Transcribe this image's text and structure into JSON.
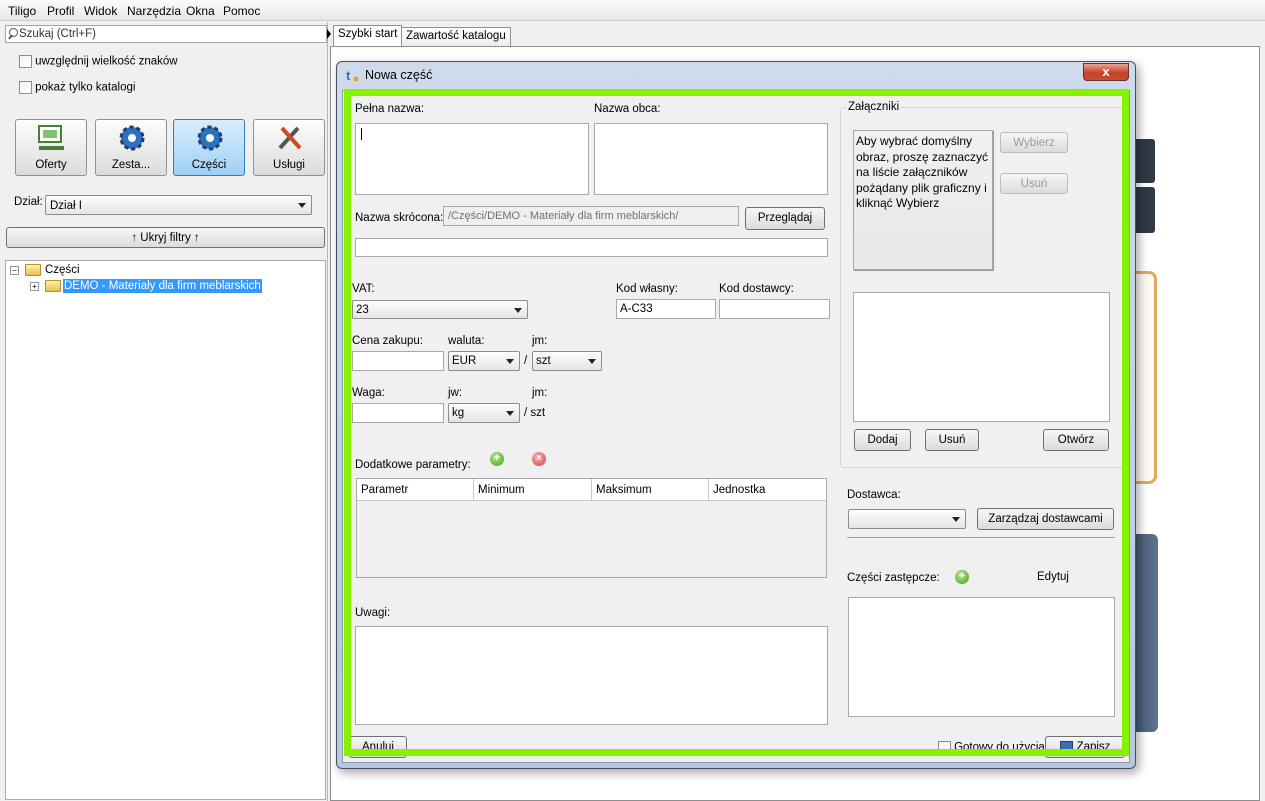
{
  "menu": [
    "Tiligo",
    "Profil",
    "Widok",
    "Narzędzia",
    "Okna",
    "Pomoc"
  ],
  "left": {
    "search_placeholder": "Szukaj (Ctrl+F)",
    "opt_case": "uwzględnij wielkość znaków",
    "opt_catalogs": "pokaż tylko katalogi",
    "modules": [
      "Oferty",
      "Zesta...",
      "Części",
      "Usługi"
    ],
    "dzial_label": "Dział:",
    "dzial_value": "Dział I",
    "filters_button": "↑ Ukryj filtry ↑",
    "tree_root": "Części",
    "tree_child": "DEMO - Materiały dla firm meblarskich"
  },
  "tabs": [
    "Szybki start",
    "Zawartość katalogu"
  ],
  "dialog": {
    "title": "Nowa część",
    "close": "x",
    "full_name_label": "Pełna nazwa:",
    "foreign_name_label": "Nazwa obca:",
    "short_name_label": "Nazwa skrócona:",
    "path_value": "/Części/DEMO - Materiały dla firm meblarskich/",
    "browse_button": "Przeglądaj",
    "vat_label": "VAT:",
    "vat_value": "23",
    "own_code_label": "Kod własny:",
    "own_code_value": "A-C33",
    "supplier_code_label": "Kod dostawcy:",
    "price_label": "Cena zakupu:",
    "currency_label": "waluta:",
    "currency_value": "EUR",
    "unit_label": "jm:",
    "unit_value": "szt",
    "slash": "/",
    "weight_label": "Waga:",
    "weight_unit_label": "jw:",
    "weight_unit_value": "kg",
    "unit_label2": "jm:",
    "per_szt": "/ szt",
    "params_label": "Dodatkowe parametry:",
    "params_columns": [
      "Parametr",
      "Minimum",
      "Maksimum",
      "Jednostka"
    ],
    "notes_label": "Uwagi:",
    "cancel_button": "Anuluj",
    "ready_label": "Gotowy do użycia",
    "save_button": "Zapisz",
    "attachments": {
      "title": "Załączniki",
      "hint": "Aby wybrać domyślny obraz, proszę zaznaczyć na liście załączników pożądany plik graficzny i kliknąć Wybierz",
      "choose_button": "Wybierz",
      "remove_button_top": "Usuń",
      "add_button": "Dodaj",
      "remove_button": "Usuń",
      "open_button": "Otwórz"
    },
    "supplier_label": "Dostawca:",
    "manage_suppliers_button": "Zarządzaj dostawcami",
    "replacement_label": "Części zastępcze:",
    "edit_label": "Edytuj"
  },
  "colors": {
    "highlight_green": "#86f100",
    "selection_blue": "#3399ff"
  }
}
